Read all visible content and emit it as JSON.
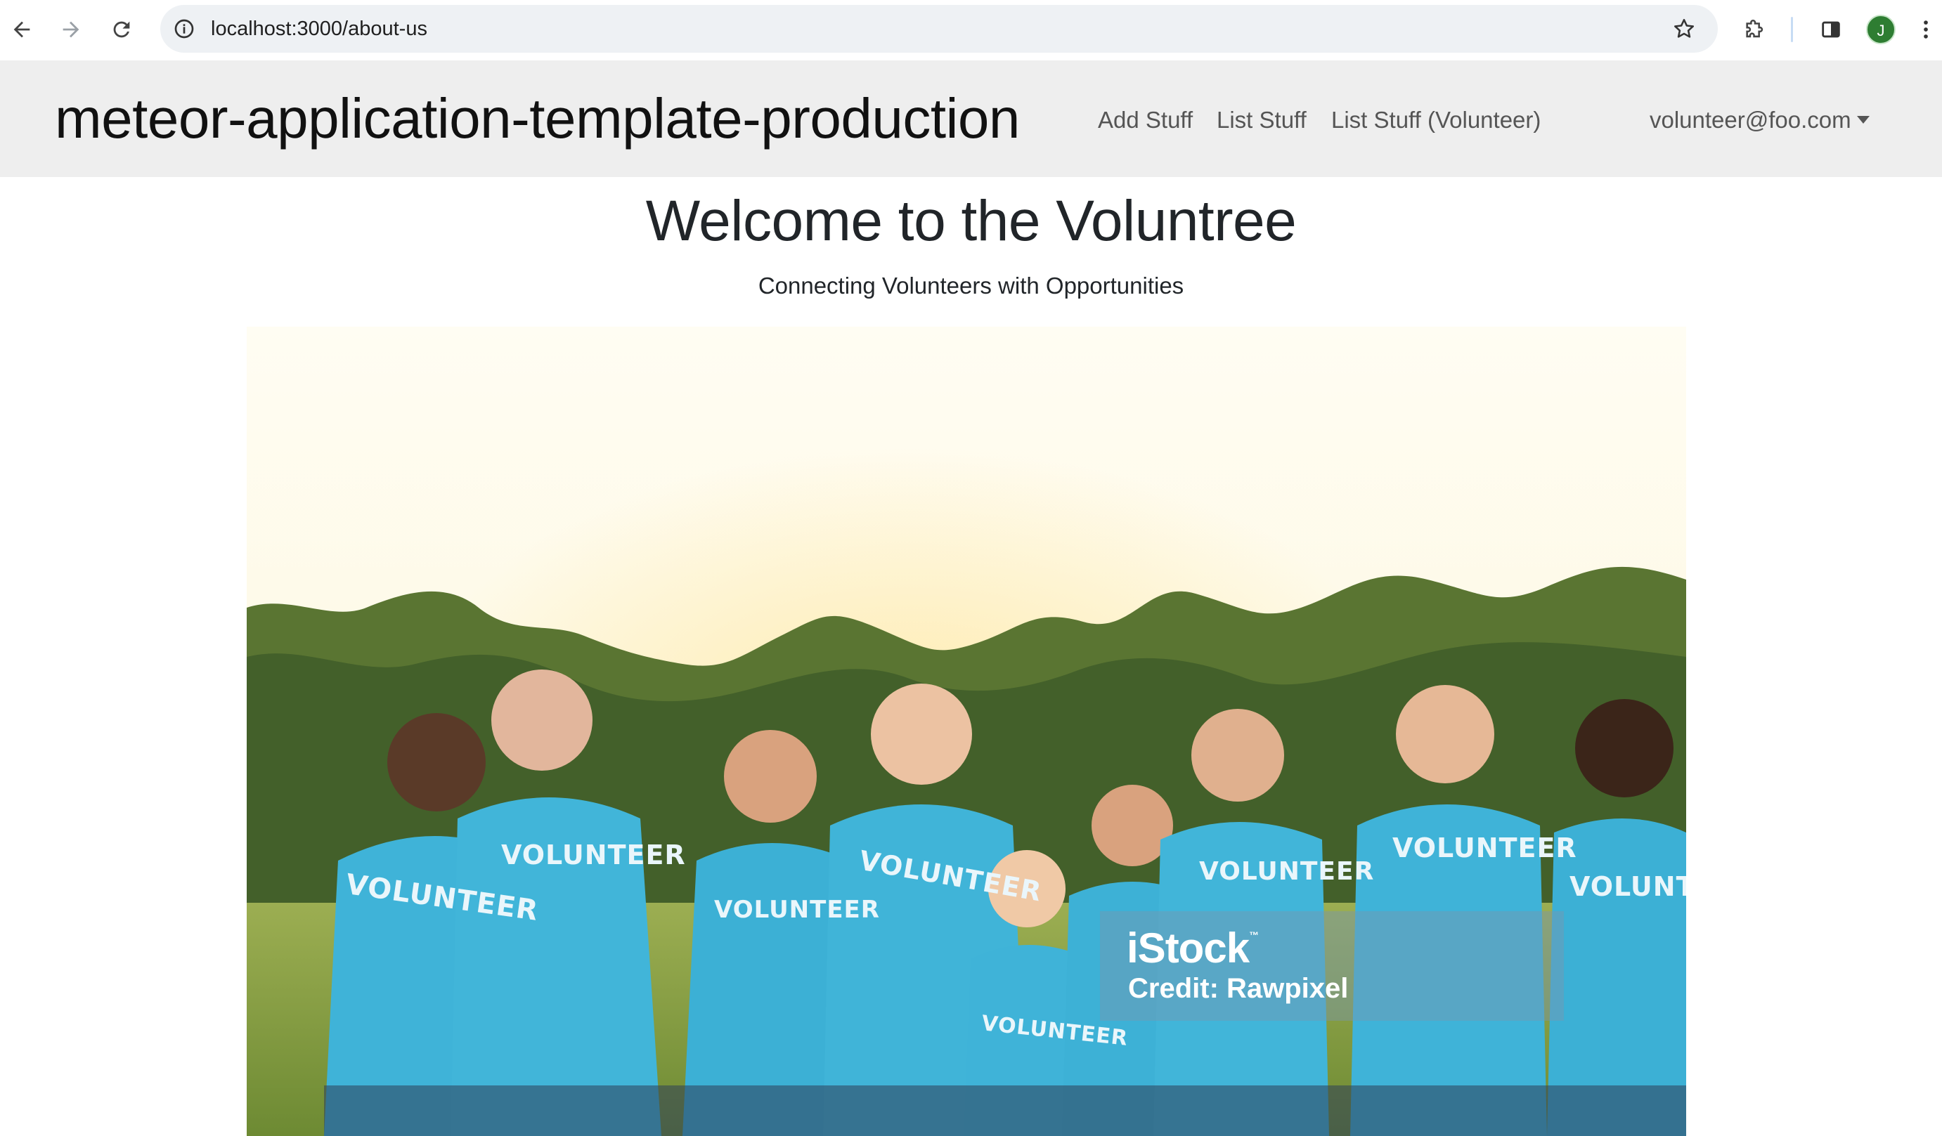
{
  "browser": {
    "url": "localhost:3000/about-us",
    "profile_initial": "J"
  },
  "navbar": {
    "brand": "meteor-application-template-production",
    "links": [
      "Add Stuff",
      "List Stuff",
      "List Stuff (Volunteer)"
    ],
    "user_email": "volunteer@foo.com"
  },
  "main": {
    "title": "Welcome to the Voluntree",
    "subtitle": "Connecting Volunteers with Opportunities",
    "hero_image": {
      "watermark_brand": "iStock",
      "watermark_tm": "™",
      "watermark_credit": "Credit: Rawpixel",
      "shirt_text": "VOLUNTEER"
    }
  },
  "colors": {
    "navbar_bg": "#eeeeee",
    "shirt_blue": "#3fb3d8",
    "sky": "#fffbec",
    "avatar_green": "#2e7d32"
  },
  "icons": [
    "back-icon",
    "forward-icon",
    "reload-icon",
    "site-info-icon",
    "bookmark-star-icon",
    "extensions-icon",
    "side-panel-icon",
    "profile-avatar",
    "kebab-menu-icon"
  ]
}
